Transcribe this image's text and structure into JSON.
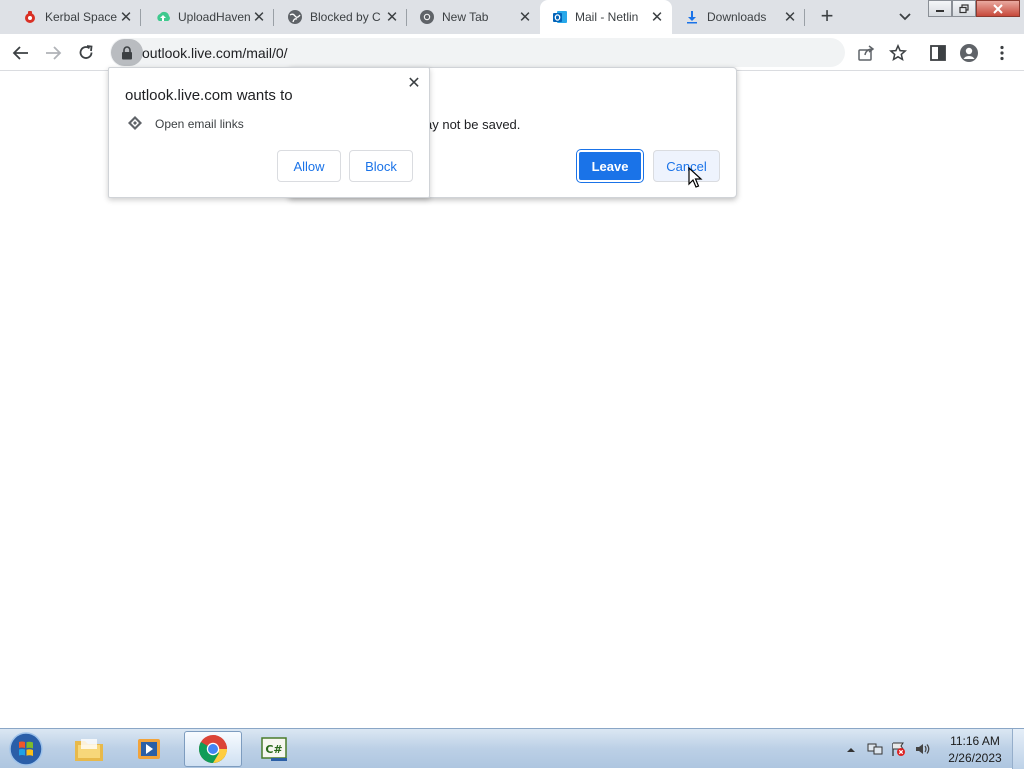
{
  "browser": {
    "tabs": [
      {
        "title": "Kerbal Space",
        "icon": "kerbal-icon",
        "active": false
      },
      {
        "title": "UploadHaven",
        "icon": "uploadhaven-icon",
        "active": false
      },
      {
        "title": "Blocked by C",
        "icon": "globe-icon",
        "active": false
      },
      {
        "title": "New Tab",
        "icon": "chrome-icon",
        "active": false
      },
      {
        "title": "Mail - Netlin",
        "icon": "outlook-icon",
        "active": true
      },
      {
        "title": "Downloads",
        "icon": "download-icon",
        "active": false
      }
    ],
    "url": "outlook.live.com/mail/0/"
  },
  "leave_dialog": {
    "message_fragment": "ay not be saved.",
    "leave_label": "Leave",
    "cancel_label": "Cancel"
  },
  "permission_bubble": {
    "title": "outlook.live.com wants to",
    "item": "Open email links",
    "allow_label": "Allow",
    "block_label": "Block"
  },
  "taskbar": {
    "apps": [
      {
        "name": "file-explorer",
        "icon": "folder-icon",
        "active": false
      },
      {
        "name": "media-player",
        "icon": "media-player-icon",
        "active": false
      },
      {
        "name": "chrome",
        "icon": "chrome-icon",
        "active": true
      },
      {
        "name": "csharp",
        "icon": "csharp-icon",
        "active": false
      }
    ],
    "time": "11:16 AM",
    "date": "2/26/2023"
  },
  "colors": {
    "accent": "#1a73e8",
    "tabstrip": "#dee1e6"
  }
}
